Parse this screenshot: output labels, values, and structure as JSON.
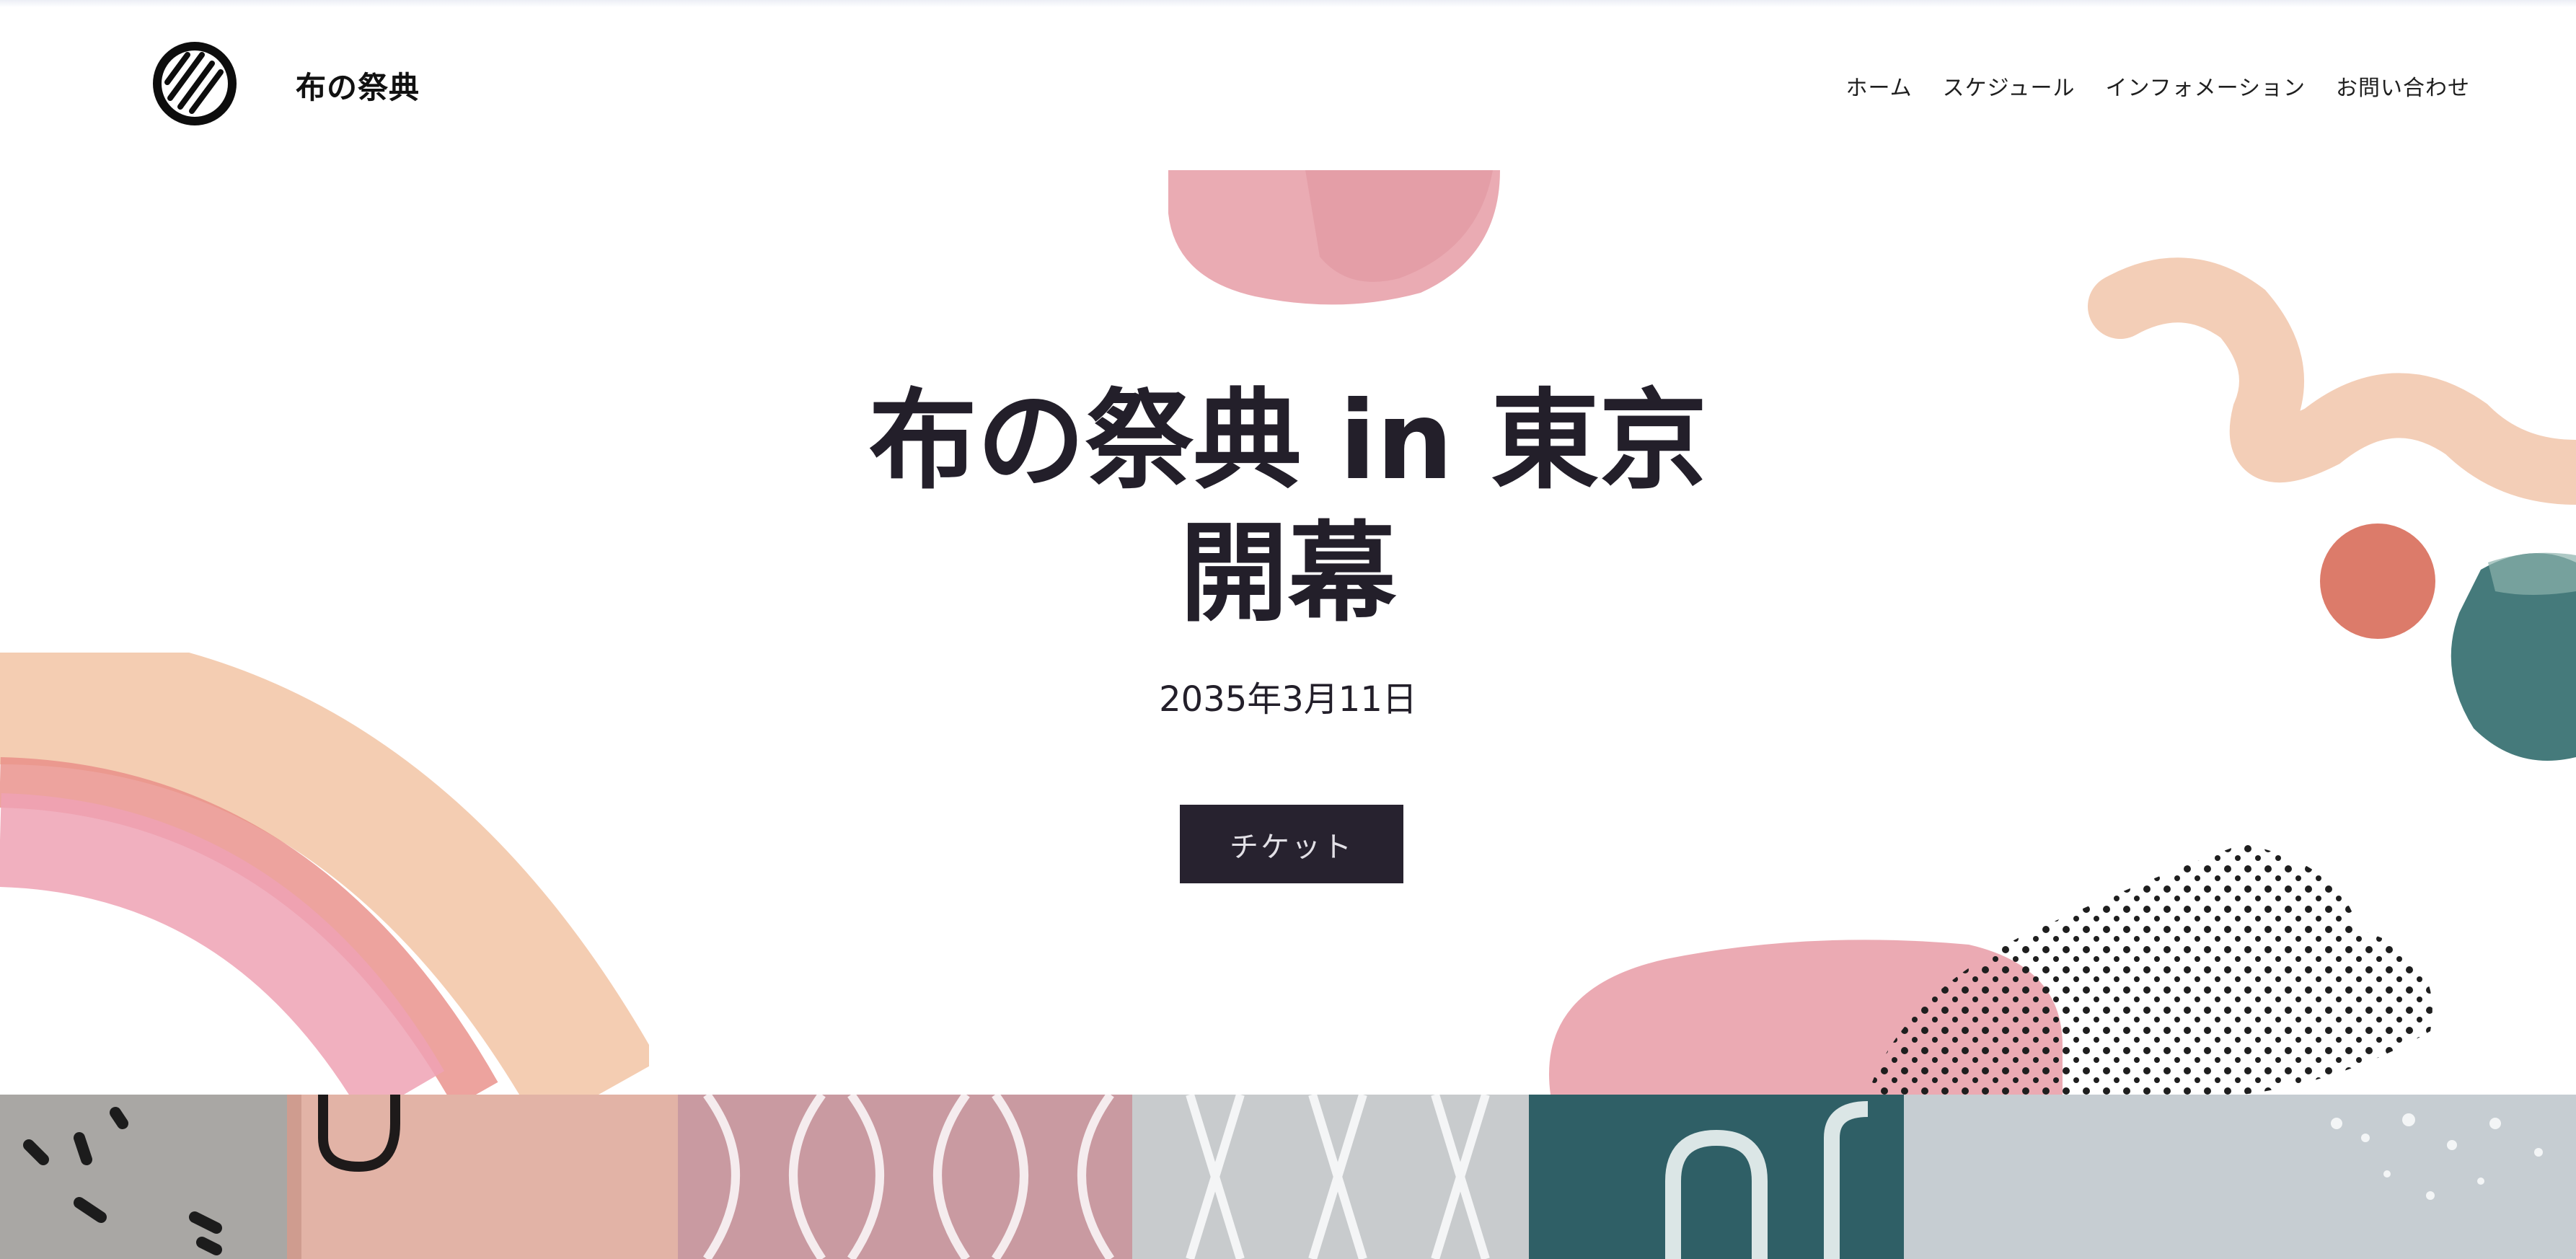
{
  "header": {
    "brand": "布の祭典",
    "logo_icon": "striped-circle-logo",
    "nav": [
      {
        "label": "ホーム"
      },
      {
        "label": "スケジュール"
      },
      {
        "label": "インフォメーション"
      },
      {
        "label": "お問い合わせ"
      }
    ]
  },
  "hero": {
    "title_line1": "布の祭典 in 東京",
    "title_line2": "開幕",
    "date": "2035年3月11日",
    "ticket_label": "チケット"
  },
  "colors": {
    "text_dark": "#231f2a",
    "button_bg": "#27222f",
    "watercolor_pink": "#e9a4ad",
    "watercolor_peach": "#f2c9ad",
    "watercolor_coral": "#dc7865",
    "watercolor_teal": "#3e7677"
  }
}
